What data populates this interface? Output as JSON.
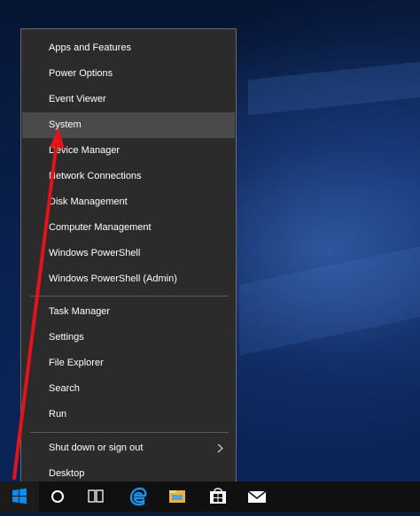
{
  "menu": {
    "group1": [
      "Apps and Features",
      "Power Options",
      "Event Viewer",
      "System",
      "Device Manager",
      "Network Connections",
      "Disk Management",
      "Computer Management",
      "Windows PowerShell",
      "Windows PowerShell (Admin)"
    ],
    "group2": [
      "Task Manager",
      "Settings",
      "File Explorer",
      "Search",
      "Run"
    ],
    "group3": [
      "Shut down or sign out",
      "Desktop"
    ],
    "highlighted_item": "System"
  },
  "taskbar": {
    "icons": [
      "windows-start-icon",
      "cortana-icon",
      "task-view-icon",
      "edge-icon",
      "file-explorer-icon",
      "store-icon",
      "mail-icon"
    ]
  },
  "colors": {
    "menu_bg": "#2b2b2b",
    "menu_highlight": "#4a4a4a",
    "start_blue": "#0a8cf0",
    "arrow_red": "#e0151b"
  }
}
